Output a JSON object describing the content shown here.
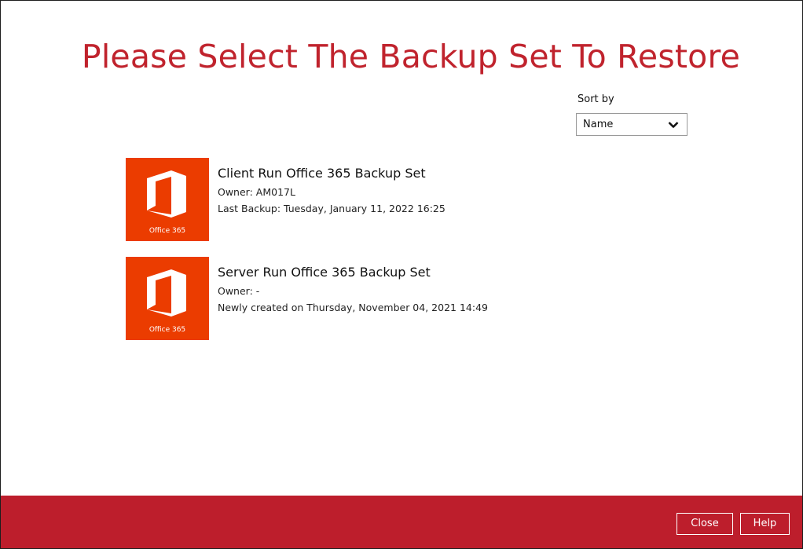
{
  "page": {
    "title": "Please Select The Backup Set To Restore"
  },
  "sort": {
    "label": "Sort by",
    "selected": "Name",
    "chevron_icon": "chevron-down-icon"
  },
  "backup_sets": [
    {
      "name": "Client Run Office 365 Backup Set",
      "owner": "Owner: AM017L",
      "detail": "Last Backup: Tuesday, January 11, 2022 16:25",
      "tile_label": "Office 365",
      "icon": "office-365-icon"
    },
    {
      "name": "Server Run Office 365 Backup Set",
      "owner": "Owner: -",
      "detail": "Newly created on Thursday, November 04, 2021 14:49",
      "tile_label": "Office 365",
      "icon": "office-365-icon"
    }
  ],
  "footer": {
    "close_label": "Close",
    "help_label": "Help"
  },
  "colors": {
    "accent": "#c0232d",
    "footer": "#bd1e2c",
    "tile": "#eb3c00"
  }
}
